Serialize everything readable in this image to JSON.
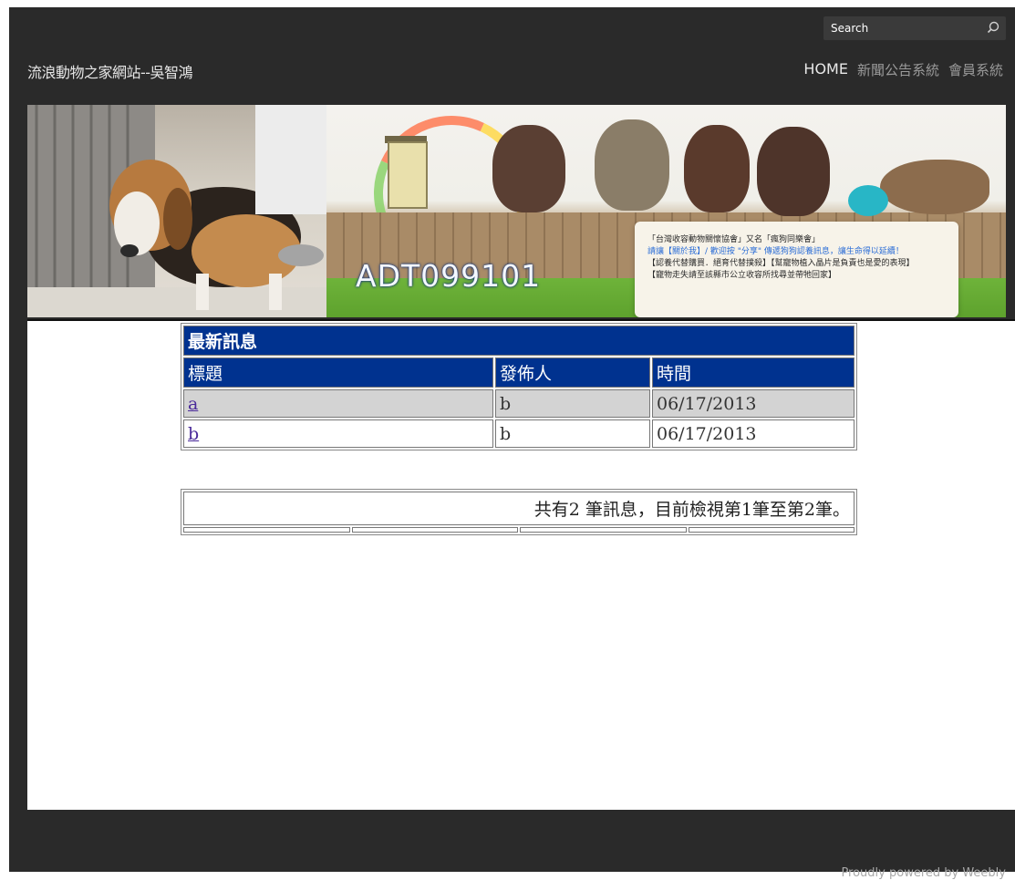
{
  "header": {
    "site_title": "流浪動物之家網站--吳智鴻",
    "search": {
      "placeholder": "Search",
      "icon": "search-icon"
    },
    "nav": [
      {
        "label": "HOME"
      },
      {
        "label": "新聞公告系統"
      },
      {
        "label": "會員系統"
      }
    ]
  },
  "banner": {
    "id_text": "ADT099101",
    "note_lines": [
      "「台灣收容動物關懷協會」又名「瘋狗同樂會」",
      "請讓【關於我】/ 歡迎按 \"分享\" 傳遞狗狗認養訊息，讓生命得以延續！",
      "【認養代替購買．絕育代替撲殺】【幫寵物植入晶片是負責也是愛的表現】",
      "【寵物走失請至該縣市公立收容所找尋並帶牠回家】"
    ]
  },
  "news_table": {
    "title": "最新訊息",
    "columns": [
      "標題",
      "發佈人",
      "時間"
    ],
    "rows": [
      {
        "title": "a",
        "publisher": "b",
        "time": "06/17/2013"
      },
      {
        "title": "b",
        "publisher": "b",
        "time": "06/17/2013"
      }
    ]
  },
  "pager": {
    "summary": "共有2 筆訊息，目前檢視第1筆至第2筆。"
  },
  "footer": {
    "text": "Proudly powered by Weebly"
  },
  "colors": {
    "header_bg": "#2a2a2a",
    "table_header_bg": "#00328f",
    "row_gray": "#d3d3d3",
    "link": "#4a2a9a"
  }
}
